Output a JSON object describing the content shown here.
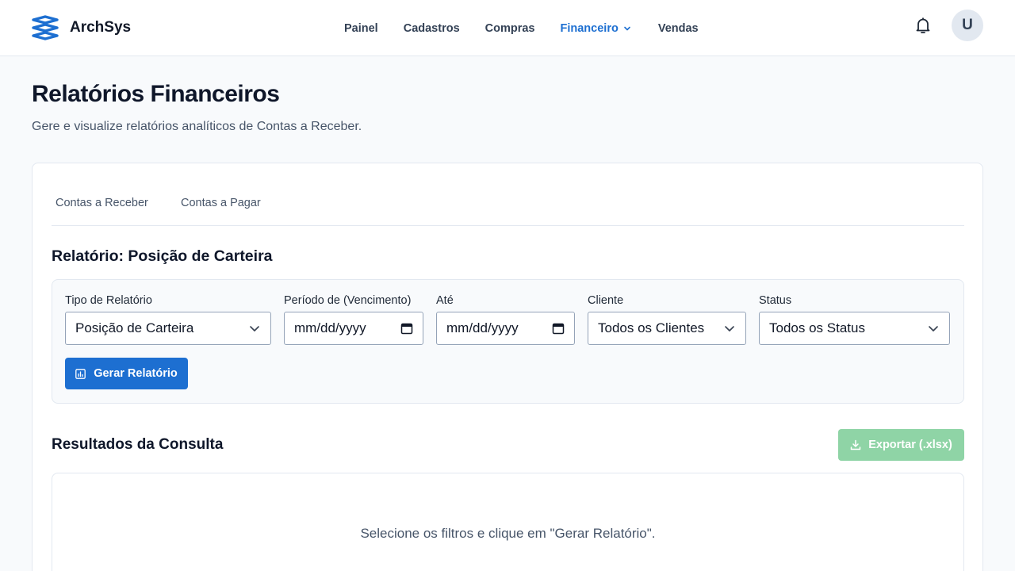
{
  "app": {
    "name": "ArchSys",
    "avatar_initial": "U"
  },
  "nav": {
    "items": [
      {
        "label": "Painel"
      },
      {
        "label": "Cadastros"
      },
      {
        "label": "Compras"
      },
      {
        "label": "Financeiro",
        "active": true
      },
      {
        "label": "Vendas"
      }
    ]
  },
  "page": {
    "title": "Relatórios Financeiros",
    "subtitle": "Gere e visualize relatórios analíticos de Contas a Receber."
  },
  "tabs": [
    {
      "label": "Contas a Receber"
    },
    {
      "label": "Contas a Pagar"
    }
  ],
  "report": {
    "title": "Relatório: Posição de Carteira",
    "filters": {
      "report_type": {
        "label": "Tipo de Relatório",
        "value": "Posição de Carteira"
      },
      "period_from": {
        "label": "Período de (Vencimento)",
        "value": "mm/dd/yyyy"
      },
      "period_to": {
        "label": "Até",
        "value": "mm/dd/yyyy"
      },
      "client": {
        "label": "Cliente",
        "value": "Todos os Clientes"
      },
      "status": {
        "label": "Status",
        "value": "Todos os Status"
      }
    },
    "generate_label": "Gerar Relatório"
  },
  "results": {
    "title": "Resultados da Consulta",
    "export_label": "Exportar (.xlsx)",
    "empty_message": "Selecione os filtros e clique em \"Gerar Relatório\"."
  },
  "colors": {
    "primary": "#1d6fd1",
    "export_disabled": "#8fd4a6",
    "text_dark": "#0f172a",
    "text_muted": "#475569",
    "border": "#e2e8f0",
    "background": "#f8fafc"
  }
}
